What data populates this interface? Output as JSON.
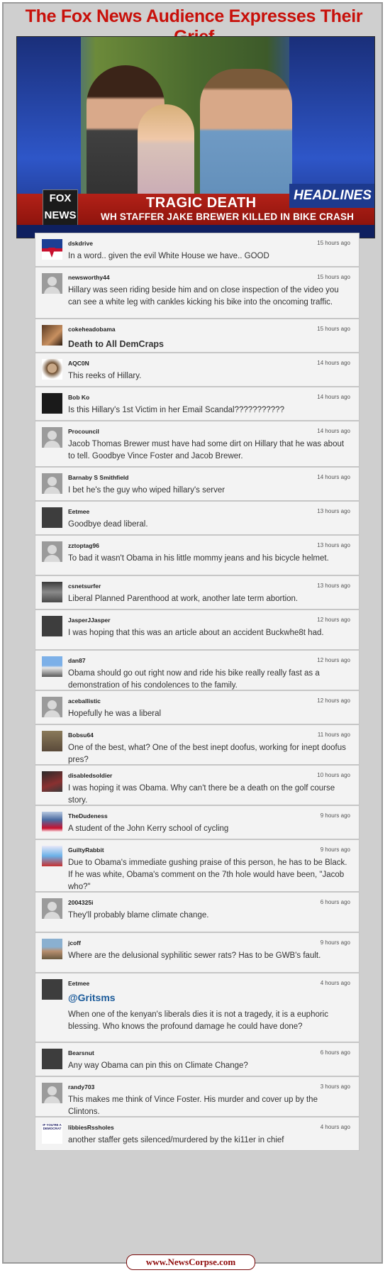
{
  "page": {
    "title": "The Fox News Audience Expresses Their Grief",
    "footer_link": "www.NewsCorpse.com"
  },
  "video": {
    "network": "FOX NEWS",
    "headline": "TRAGIC DEATH",
    "subheadline": "WH STAFFER JAKE BREWER KILLED IN BIKE CRASH",
    "segment": "HEADLINES"
  },
  "comments": [
    {
      "username": "dskdrive",
      "timestamp": "15 hours ago",
      "text": "In a word.. given the evil White House we have.. GOOD",
      "avatar": "flag"
    },
    {
      "username": "newsworthy44",
      "timestamp": "15 hours ago",
      "text": "Hillary was seen riding beside him and on close inspection of the video you can see a white leg with cankles kicking his bike into the oncoming traffic.",
      "avatar": "default"
    },
    {
      "username": "cokeheadobama",
      "timestamp": "15 hours ago",
      "text": "Death to All DemCraps",
      "avatar": "photo1"
    },
    {
      "username": "AQC0N",
      "timestamp": "14 hours ago",
      "text": "This reeks of Hillary.",
      "avatar": "photo2"
    },
    {
      "username": "Bob Ko",
      "timestamp": "14 hours ago",
      "text": "Is this Hillary's 1st Victim in her Email Scandal???????????",
      "avatar": "photo3"
    },
    {
      "username": "Procouncil",
      "timestamp": "14 hours ago",
      "text": "Jacob Thomas Brewer must have had some dirt on Hillary that he was about to tell.  Goodbye Vince Foster and Jacob Brewer.",
      "avatar": "default"
    },
    {
      "username": "Barnaby S Smithfield",
      "timestamp": "14 hours ago",
      "text": "I bet he's the guy who wiped hillary's server",
      "avatar": "default"
    },
    {
      "username": "Eetmee",
      "timestamp": "13 hours ago",
      "text": "Goodbye dead liberal.",
      "avatar": "dark"
    },
    {
      "username": "zztoptag96",
      "timestamp": "13 hours ago",
      "text": "To bad it wasn't Obama in his little mommy jeans and his bicycle helmet.",
      "avatar": "default"
    },
    {
      "username": "csnetsurfer",
      "timestamp": "13 hours ago",
      "text": "Liberal Planned Parenthood at work, another late term abortion.",
      "avatar": "photo4"
    },
    {
      "username": "JasperJJasper",
      "timestamp": "12 hours ago",
      "text": "I was hoping that this was an article about an accident Buckwhe8t had.",
      "avatar": "dark"
    },
    {
      "username": "dan87",
      "timestamp": "12 hours ago",
      "text": "Obama should go out right now and ride his bike really really fast as a demonstration of his condolences to the family.",
      "avatar": "photo5"
    },
    {
      "username": "aceballistic",
      "timestamp": "12 hours ago",
      "text": "Hopefully he was a liberal",
      "avatar": "default"
    },
    {
      "username": "Bobsu64",
      "timestamp": "11 hours ago",
      "text": "One of the best, what? One of the best inept doofus, working for inept doofus pres?",
      "avatar": "photo6"
    },
    {
      "username": "disabledsoldier",
      "timestamp": "10 hours ago",
      "text": "I was hoping it was Obama.  Why can't there be a death on the golf course story.",
      "avatar": "photo7"
    },
    {
      "username": "TheDudeness",
      "timestamp": "9 hours ago",
      "text": "A student of the John Kerry school of cycling",
      "avatar": "photo8"
    },
    {
      "username": "GuiltyRabbit",
      "timestamp": "9 hours ago",
      "text": "Due to Obama's immediate gushing praise of this person, he has to be Black. If he was white, Obama's comment on the 7th hole would have been, \"Jacob who?\"",
      "avatar": "photo9"
    },
    {
      "username": "2004325i",
      "timestamp": "6 hours ago",
      "text": "They'll probably blame climate change.",
      "avatar": "default"
    },
    {
      "username": "jcoff",
      "timestamp": "9 hours ago",
      "text": "Where are the delusional syphilitic sewer rats?  Has to be GWB's fault.",
      "avatar": "photo10"
    },
    {
      "username": "Eetmee",
      "timestamp": "4 hours ago",
      "mention": "@Gritsms",
      "text": "When one of the kenyan's liberals dies it is not a tragedy, it is a euphoric blessing.  Who knows the profound damage he could have done?",
      "avatar": "dark"
    },
    {
      "username": "Bearsnut",
      "timestamp": "6 hours ago",
      "text": "Any way Obama can pin this on Climate Change?",
      "avatar": "dark"
    },
    {
      "username": "randy703",
      "timestamp": "3 hours ago",
      "text": "This makes me think of Vince Foster.  His murder and cover up by the Clintons.",
      "avatar": "default"
    },
    {
      "username": "libbiesRssholes",
      "timestamp": "4 hours ago",
      "text": "another staffer gets silenced/murdered by the ki11er in chief",
      "avatar": "photo11",
      "avatar_text": "IF YOU'RE A DEMOCRAT"
    }
  ]
}
